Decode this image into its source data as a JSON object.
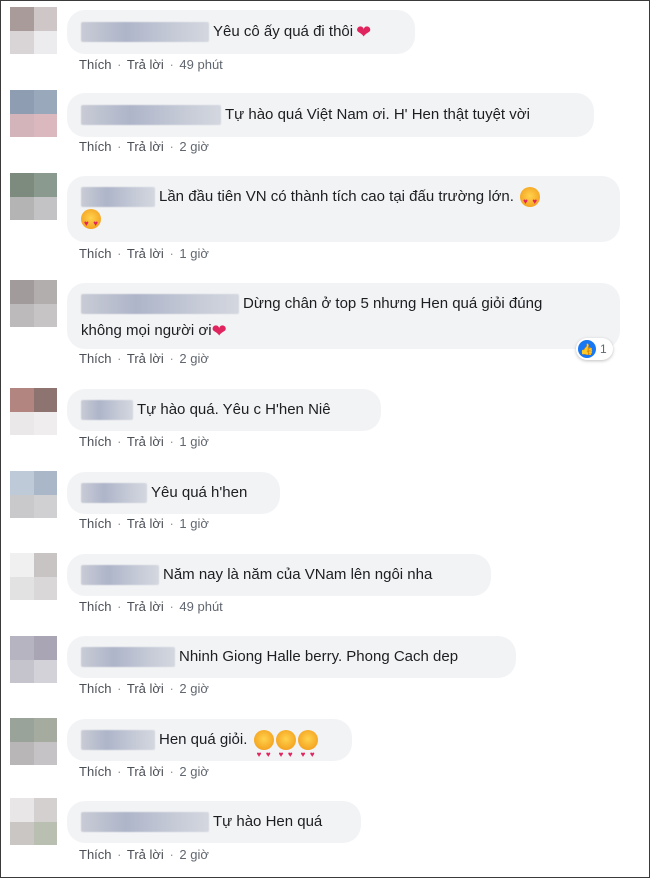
{
  "actions": {
    "like_label": "Thích",
    "reply_label": "Trả lời",
    "separator": "·"
  },
  "comments": [
    {
      "text": "Yêu cô ấy quá đi thôi",
      "time": "49 phút",
      "heart": "❤"
    },
    {
      "text": "Tự hào quá Việt Nam ơi. H' Hen thật tuyệt vời",
      "time": "2 giờ"
    },
    {
      "text": "Lần đầu tiên VN có thành tích cao tại đấu trường lớn.",
      "time": "1 giờ",
      "emoji": "smiling-cat-heart-eyes"
    },
    {
      "text": "Dừng chân ở top 5 nhưng Hen quá giỏi đúng",
      "text2": "không mọi người ơi",
      "time": "2 giờ",
      "heart": "❤",
      "reaction_count": "1"
    },
    {
      "text": "Tự hào quá. Yêu c H'hen Niê",
      "time": "1 giờ"
    },
    {
      "text": "Yêu quá h'hen",
      "time": "1 giờ"
    },
    {
      "text": "Năm nay là năm của VNam lên ngôi nha",
      "time": "49 phút"
    },
    {
      "text": "Nhinh Giong Halle berry. Phong Cach dep",
      "time": "2 giờ"
    },
    {
      "text": "Hen quá giỏi.",
      "time": "2 giờ",
      "emoji": "smiling-cat-heart-eyes"
    },
    {
      "text": "Tự hào Hen quá",
      "time": "2 giờ"
    }
  ],
  "colors": {
    "bubble": "#f2f3f5",
    "like_blue": "#1877f2",
    "heart_red": "#e0245e"
  },
  "icons": {
    "reaction": "like-thumb-icon"
  }
}
